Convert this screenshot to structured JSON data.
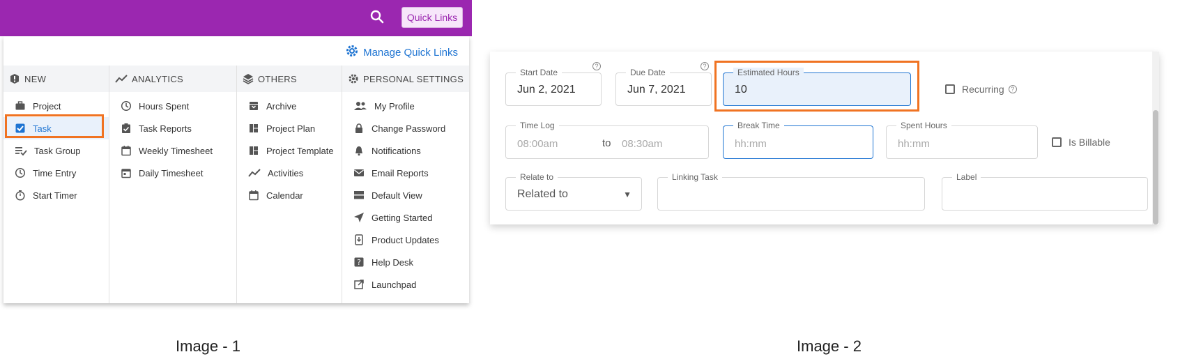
{
  "image1": {
    "quick_links_label": "Quick Links",
    "manage_label": "Manage Quick Links",
    "categories": [
      {
        "label": "NEW",
        "items": [
          {
            "label": "Project",
            "icon": "briefcase-icon"
          },
          {
            "label": "Task",
            "icon": "checkbox-icon",
            "selected": true
          },
          {
            "label": "Task Group",
            "icon": "task-group-icon"
          },
          {
            "label": "Time Entry",
            "icon": "clock-icon"
          },
          {
            "label": "Start Timer",
            "icon": "stopwatch-icon"
          }
        ]
      },
      {
        "label": "ANALYTICS",
        "items": [
          {
            "label": "Hours Spent",
            "icon": "clock-icon"
          },
          {
            "label": "Task Reports",
            "icon": "clipboard-check-icon"
          },
          {
            "label": "Weekly Timesheet",
            "icon": "calendar-icon"
          },
          {
            "label": "Daily Timesheet",
            "icon": "calendar-day-icon"
          }
        ]
      },
      {
        "label": "OTHERS",
        "items": [
          {
            "label": "Archive",
            "icon": "archive-icon"
          },
          {
            "label": "Project Plan",
            "icon": "grid-icon"
          },
          {
            "label": "Project Template",
            "icon": "grid-icon"
          },
          {
            "label": "Activities",
            "icon": "trend-icon"
          },
          {
            "label": "Calendar",
            "icon": "calendar-icon"
          }
        ]
      },
      {
        "label": "PERSONAL SETTINGS",
        "items": [
          {
            "label": "My Profile",
            "icon": "people-icon"
          },
          {
            "label": "Change Password",
            "icon": "lock-icon"
          },
          {
            "label": "Notifications",
            "icon": "bell-icon"
          },
          {
            "label": "Email Reports",
            "icon": "mail-icon"
          },
          {
            "label": "Default View",
            "icon": "view-icon"
          },
          {
            "label": "Getting Started",
            "icon": "send-icon"
          },
          {
            "label": "Product Updates",
            "icon": "download-icon"
          },
          {
            "label": "Help Desk",
            "icon": "help-icon"
          },
          {
            "label": "Launchpad",
            "icon": "external-link-icon"
          }
        ]
      }
    ],
    "caption": "Image - 1"
  },
  "image2": {
    "start_date": {
      "label": "Start Date",
      "value": "Jun 2, 2021"
    },
    "due_date": {
      "label": "Due Date",
      "value": "Jun 7, 2021"
    },
    "estimated_hours": {
      "label": "Estimated Hours",
      "value": "10"
    },
    "recurring_label": "Recurring",
    "time_log": {
      "label": "Time Log",
      "from": "08:00am",
      "to_label": "to",
      "to": "08:30am"
    },
    "break_time": {
      "label": "Break Time",
      "placeholder": "hh:mm"
    },
    "spent_hours": {
      "label": "Spent Hours",
      "placeholder": "hh:mm"
    },
    "billable_label": "Is Billable",
    "relate_to": {
      "label": "Relate to",
      "value": "Related to"
    },
    "linking_task_label": "Linking Task",
    "label_label": "Label",
    "caption": "Image - 2"
  },
  "colors": {
    "brand": "#9b27b0",
    "accent": "#1e74d2",
    "highlight": "#f07322"
  }
}
